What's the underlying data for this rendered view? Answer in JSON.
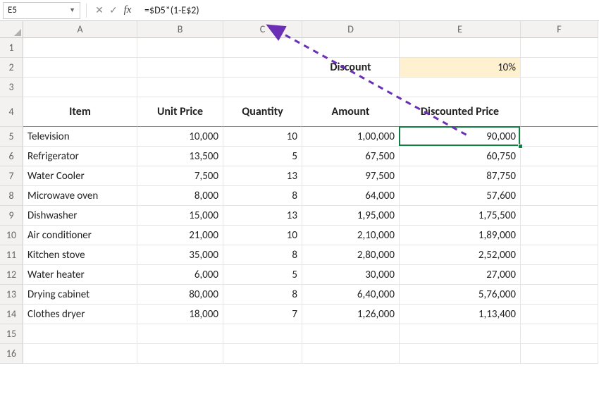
{
  "name_box": "E5",
  "formula": "=$D5*(1-E$2)",
  "col_widths": {
    "A": 162,
    "B": 122,
    "C": 112,
    "D": 138,
    "E": 172,
    "F": 110
  },
  "col_labels": [
    "A",
    "B",
    "C",
    "D",
    "E",
    "F"
  ],
  "row_count": 16,
  "discount": {
    "label": "Discount",
    "value": "10%"
  },
  "headers": {
    "item": "Item",
    "unit_price": "Unit Price",
    "quantity": "Quantity",
    "amount": "Amount",
    "discounted": "Discounted Price"
  },
  "rows": [
    {
      "item": "Television",
      "unit_price": "10,000",
      "qty": "10",
      "amount": "1,00,000",
      "disc": "90,000"
    },
    {
      "item": "Refrigerator",
      "unit_price": "13,500",
      "qty": "5",
      "amount": "67,500",
      "disc": "60,750"
    },
    {
      "item": "Water Cooler",
      "unit_price": "7,500",
      "qty": "13",
      "amount": "97,500",
      "disc": "87,750"
    },
    {
      "item": "Microwave oven",
      "unit_price": "8,000",
      "qty": "8",
      "amount": "64,000",
      "disc": "57,600"
    },
    {
      "item": "Dishwasher",
      "unit_price": "15,000",
      "qty": "13",
      "amount": "1,95,000",
      "disc": "1,75,500"
    },
    {
      "item": "Air conditioner",
      "unit_price": "21,000",
      "qty": "10",
      "amount": "2,10,000",
      "disc": "1,89,000"
    },
    {
      "item": "Kitchen stove",
      "unit_price": "35,000",
      "qty": "8",
      "amount": "2,80,000",
      "disc": "2,52,000"
    },
    {
      "item": "Water heater",
      "unit_price": "6,000",
      "qty": "5",
      "amount": "30,000",
      "disc": "27,000"
    },
    {
      "item": "Drying cabinet",
      "unit_price": "80,000",
      "qty": "8",
      "amount": "6,40,000",
      "disc": "5,76,000"
    },
    {
      "item": "Clothes dryer",
      "unit_price": "18,000",
      "qty": "7",
      "amount": "1,26,000",
      "disc": "1,13,400"
    }
  ],
  "chart_data": {
    "type": "table",
    "title": "Spreadsheet with discount formula",
    "discount_pct": 0.1,
    "columns": [
      "Item",
      "Unit Price",
      "Quantity",
      "Amount",
      "Discounted Price"
    ],
    "records": [
      [
        "Television",
        10000,
        10,
        100000,
        90000
      ],
      [
        "Refrigerator",
        13500,
        5,
        67500,
        60750
      ],
      [
        "Water Cooler",
        7500,
        13,
        97500,
        87750
      ],
      [
        "Microwave oven",
        8000,
        8,
        64000,
        57600
      ],
      [
        "Dishwasher",
        15000,
        13,
        195000,
        175500
      ],
      [
        "Air conditioner",
        21000,
        10,
        210000,
        189000
      ],
      [
        "Kitchen stove",
        35000,
        8,
        280000,
        252000
      ],
      [
        "Water heater",
        6000,
        5,
        30000,
        27000
      ],
      [
        "Drying cabinet",
        80000,
        8,
        640000,
        576000
      ],
      [
        "Clothes dryer",
        18000,
        7,
        126000,
        113400
      ]
    ]
  }
}
